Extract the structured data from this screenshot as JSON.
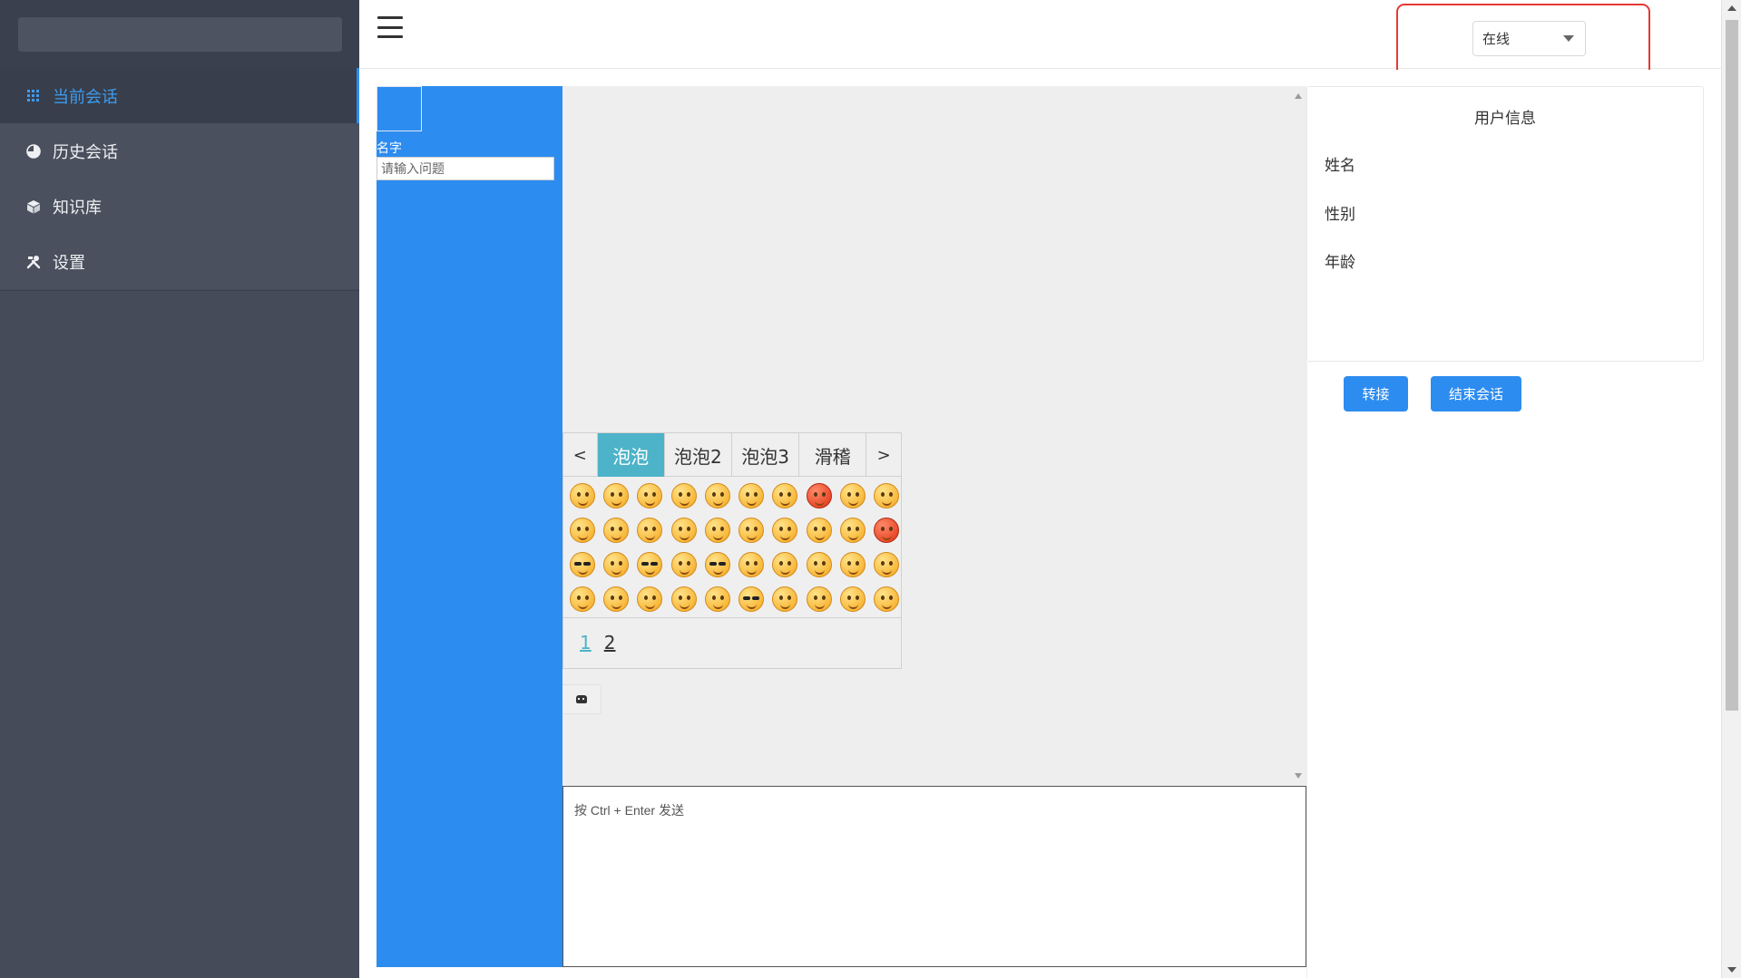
{
  "sidebar": {
    "items": [
      {
        "label": "当前会话",
        "icon": "grid-icon",
        "active": true
      },
      {
        "label": "历史会话",
        "icon": "pie-chart-icon",
        "active": false
      },
      {
        "label": "知识库",
        "icon": "cube-icon",
        "active": false
      },
      {
        "label": "设置",
        "icon": "tools-icon",
        "active": false
      }
    ]
  },
  "header": {
    "menu_icon": "hamburger-icon",
    "status": {
      "value": "在线",
      "icon": "caret-down-icon"
    }
  },
  "customer": {
    "name_label": "名字",
    "question_placeholder": "请输入问题"
  },
  "emoji_panel": {
    "prev": "<",
    "next": ">",
    "tabs": [
      {
        "label": "泡泡",
        "active": true
      },
      {
        "label": "泡泡2",
        "active": false
      },
      {
        "label": "泡泡3",
        "active": false
      },
      {
        "label": "滑稽",
        "active": false
      }
    ],
    "pages": [
      {
        "label": "1",
        "active": true
      },
      {
        "label": "2",
        "active": false
      }
    ]
  },
  "robot_button": {
    "icon": "robot-icon"
  },
  "message_input": {
    "placeholder": "按 Ctrl + Enter 发送"
  },
  "user_info": {
    "title": "用户信息",
    "name_label": "姓名",
    "gender_label": "性别",
    "age_label": "年龄"
  },
  "actions": {
    "transfer": "转接",
    "end_session": "结束会话"
  },
  "colors": {
    "sidebar_bg": "#454b59",
    "active_accent": "#2d8cf0",
    "emoji_tab_active": "#4db3c8",
    "highlight_box": "#e53935"
  }
}
